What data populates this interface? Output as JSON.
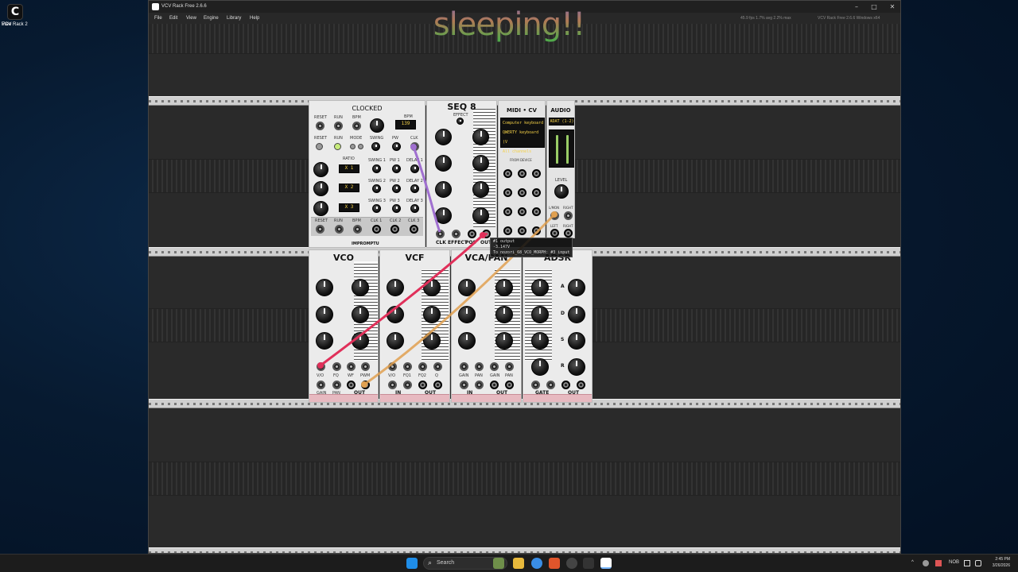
{
  "desktop": {
    "icon_label_1": "VCV Rack 2",
    "icon_label_2": "Free"
  },
  "window": {
    "title": "VCV Rack Free 2.6.6",
    "controls": [
      "–",
      "□",
      "✕"
    ]
  },
  "menu": [
    "File",
    "Edit",
    "View",
    "Engine",
    "Library",
    "Help"
  ],
  "status": {
    "perf": "45.9 fps  1.7% avg  2.2% max",
    "version": "VCV Rack Free 2.6.6 Windows x64"
  },
  "overlay_text": "sleeping!!",
  "modules": {
    "clocked": {
      "title": "CLOCKED",
      "brand": "IMPROMPTU",
      "bpm_label": "BPM",
      "bpm_display": "139",
      "row1": [
        "RESET",
        "RUN",
        "BPM"
      ],
      "row2": [
        "RESET",
        "RUN",
        "MODE",
        "SWING",
        "PW",
        "CLK"
      ],
      "ratio_label": "RATIO",
      "swing": [
        "SWING 1",
        "SWING 2",
        "SWING 3"
      ],
      "pw": [
        "PW 1",
        "PW 2",
        "PW 3"
      ],
      "delay": [
        "DELAY 1",
        "DELAY 2",
        "DELAY 3"
      ],
      "ratio_displays": [
        "X 1",
        "X 2",
        "X 3"
      ],
      "io": [
        "RESET",
        "RUN",
        "BPM",
        "CLK 1",
        "CLK 2",
        "CLK 3"
      ]
    },
    "seq8": {
      "title": "SEQ 8",
      "effect": "EFFECT",
      "io": [
        "CLK",
        "EFFECT",
        "POS",
        "OUT"
      ]
    },
    "midicv": {
      "title": "MIDI • CV",
      "lines": [
        "Computer keyboard",
        "QWERTY keyboard (V",
        "All channels"
      ],
      "from_device": "FROM DEVICE",
      "io": [
        "V/OCT",
        "GATE",
        "VEL",
        "AFT",
        "PW",
        "MOD",
        "CLK",
        "CLK/N",
        "RETR",
        "STRT",
        "STOP",
        "CONT"
      ]
    },
    "audio": {
      "title": "AUDIO",
      "device": "ADAT (1-2)",
      "level": "LEVEL",
      "io": [
        "L/MON",
        "RIGHT",
        "LEFT",
        "RIGHT"
      ]
    },
    "vco": {
      "title": "VCO",
      "io": [
        "V/O",
        "FQ",
        "WF",
        "PWM",
        "GAIN",
        "PAN",
        "OUT"
      ]
    },
    "vcf": {
      "title": "VCF",
      "io": [
        "V/O",
        "FQ1",
        "FQ2",
        "Q",
        "IN",
        "OUT"
      ]
    },
    "vcapan": {
      "title": "VCA/PAN",
      "io": [
        "GAIN",
        "PAN",
        "GAIN",
        "PAN",
        "IN",
        "OUT"
      ]
    },
    "adsr": {
      "title": "ADSR",
      "io": [
        "A",
        "D",
        "S",
        "R",
        "GATE",
        "OUT"
      ]
    }
  },
  "tooltip": {
    "line1": "#1 output",
    "line2": "-3.147V",
    "line3": "To nozori_68_VCO_MORPH: #3 input"
  },
  "cable_colors": {
    "red": "#e0305a",
    "purple": "#a070d0",
    "orange": "#e0a050"
  },
  "taskbar": {
    "search_placeholder": "Search",
    "lang": "NOB",
    "time": "2:45 PM",
    "date": "3/26/2026"
  }
}
